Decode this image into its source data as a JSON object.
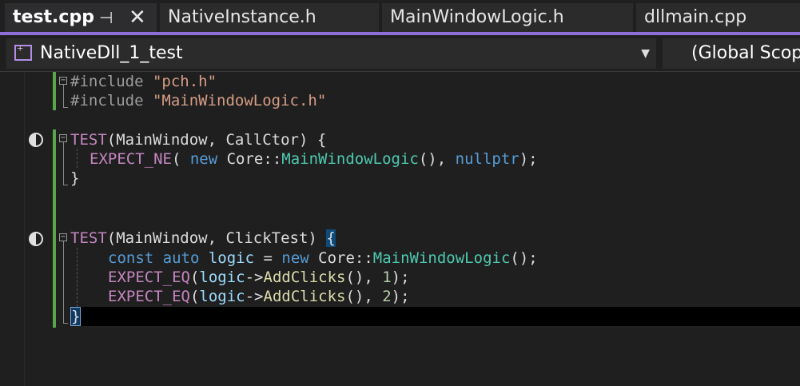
{
  "tabs": [
    {
      "label": "test.cpp",
      "active": true
    },
    {
      "label": "NativeInstance.h",
      "active": false
    },
    {
      "label": "MainWindowLogic.h",
      "active": false
    },
    {
      "label": "dllmain.cpp",
      "active": false
    }
  ],
  "tab_icons": {
    "pin": "pin-icon",
    "close": "close-icon"
  },
  "navbar": {
    "project": "NativeDll_1_test",
    "project_icon": "cpp-project-icon",
    "scope": "(Global Scop"
  },
  "colors": {
    "accent": "#8e6fd8",
    "keyword": "#569cd6",
    "string": "#d69d85",
    "macro": "#c586c0",
    "function": "#dcdcaa",
    "type": "#4ec9b0",
    "change_bar": "#57a64a"
  },
  "code": {
    "l1": {
      "directive": "#include",
      "path": "\"pch.h\""
    },
    "l2": {
      "directive": "#include",
      "path": "\"MainWindowLogic.h\""
    },
    "l4": {
      "macro": "TEST",
      "args": "(MainWindow, CallCtor) {"
    },
    "l5": {
      "macro": "EXPECT_NE",
      "p1": "( ",
      "kw": "new",
      "ns": " Core",
      "sep": "::",
      "cls": "MainWindowLogic",
      "p2": "(), ",
      "null": "nullptr",
      "p3": ");"
    },
    "l6": {
      "text": "}"
    },
    "l9": {
      "macro": "TEST",
      "args": "(MainWindow, ClickTest) ",
      "brace": "{"
    },
    "l10": {
      "kw1": "const",
      "kw2": " auto",
      "var": " logic",
      "eq": " = ",
      "kw3": "new",
      "ns": " Core",
      "sep": "::",
      "cls": "MainWindowLogic",
      "end": "();"
    },
    "l11": {
      "macro": "EXPECT_EQ",
      "p1": "(",
      "var": "logic",
      "arrow": "->",
      "fn": "AddClicks",
      "p2": "(), ",
      "num": "1",
      "end": ");"
    },
    "l12": {
      "macro": "EXPECT_EQ",
      "p1": "(",
      "var": "logic",
      "arrow": "->",
      "fn": "AddClicks",
      "p2": "(), ",
      "num": "2",
      "end": ");"
    },
    "l13": {
      "brace": "}"
    }
  },
  "gutter": {
    "test_marker_icon": "test-status-icon"
  }
}
